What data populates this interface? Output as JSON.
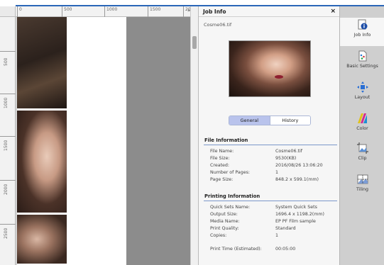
{
  "ruler": {
    "top_marks": [
      "0",
      "500",
      "1000",
      "1500",
      "200"
    ],
    "left_marks": [
      "500",
      "1000",
      "1500",
      "2000",
      "2500"
    ],
    "toggle_glyph": "»"
  },
  "panel": {
    "title": "Job Info",
    "close_glyph": "×",
    "file_name_top": "Cosme06.tif",
    "tabs": {
      "general": "General",
      "history": "History"
    },
    "file_info": {
      "title": "File Information",
      "rows": [
        {
          "label": "File Name:",
          "value": "Cosme06.tif"
        },
        {
          "label": "File Size:",
          "value": "9530(KB)"
        },
        {
          "label": "Created:",
          "value": "2016/08/26 13:06:20"
        },
        {
          "label": "Number of Pages:",
          "value": "1"
        },
        {
          "label": "Page Size:",
          "value": "848.2 x 599.1(mm)"
        }
      ]
    },
    "print_info": {
      "title": "Printing Information",
      "rows": [
        {
          "label": "Quick Sets Name:",
          "value": "System Quick Sets"
        },
        {
          "label": "Output Size:",
          "value": "1696.4 x 1198.2(mm)"
        },
        {
          "label": "Media Name:",
          "value": "EP PF Film sample"
        },
        {
          "label": "Print Quality:",
          "value": "Standard"
        },
        {
          "label": "Copies:",
          "value": "1"
        }
      ],
      "print_time": {
        "label": "Print Time (Estimated):",
        "value": "00:05:00"
      }
    }
  },
  "toolbar": {
    "items": [
      {
        "label": "Job Info",
        "icon": "job-info-icon"
      },
      {
        "label": "Basic Settings",
        "icon": "basic-settings-icon"
      },
      {
        "label": "Layout",
        "icon": "layout-icon"
      },
      {
        "label": "Color",
        "icon": "color-icon"
      },
      {
        "label": "Clip",
        "icon": "clip-icon"
      },
      {
        "label": "Tiling",
        "icon": "tiling-icon"
      }
    ]
  },
  "colors": {
    "accent": "#2a66b8",
    "tab_active": "#b9c3ec",
    "toolbar_bg": "#cfcfcf"
  }
}
